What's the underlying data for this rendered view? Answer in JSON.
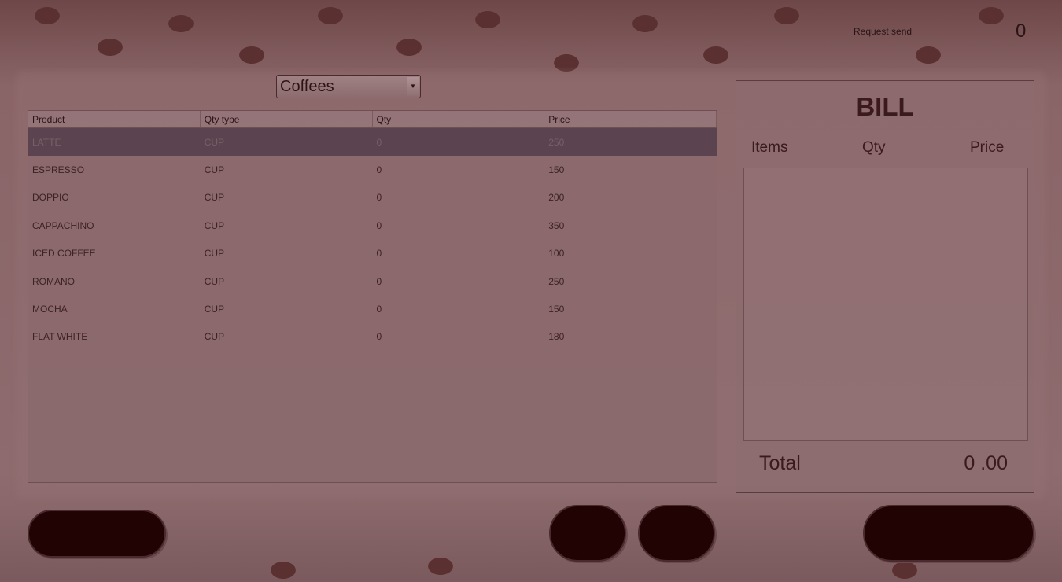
{
  "status": {
    "request_label": "Request send",
    "request_count": "0"
  },
  "category": {
    "selected": "Coffees"
  },
  "product_table": {
    "columns": [
      "Product",
      "Qty type",
      "Qty",
      "Price"
    ],
    "rows": [
      [
        "LATTE",
        "CUP",
        "0",
        "250"
      ],
      [
        "ESPRESSO",
        "CUP",
        "0",
        "150"
      ],
      [
        "DOPPIO",
        "CUP",
        "0",
        "200"
      ],
      [
        "CAPPACHINO",
        "CUP",
        "0",
        "350"
      ],
      [
        "ICED COFFEE",
        "CUP",
        "0",
        "100"
      ],
      [
        "ROMANO",
        "CUP",
        "0",
        "250"
      ],
      [
        "MOCHA",
        "CUP",
        "0",
        "150"
      ],
      [
        "FLAT WHITE",
        "CUP",
        "0",
        "180"
      ]
    ],
    "selected_row": 0
  },
  "bill": {
    "title": "BILL",
    "columns": {
      "items": "Items",
      "qty": "Qty",
      "price": "Price"
    },
    "total_label": "Total",
    "total_value": "0 .00"
  },
  "colors": {
    "button": "#210304",
    "selected_row": "#5b4450"
  }
}
